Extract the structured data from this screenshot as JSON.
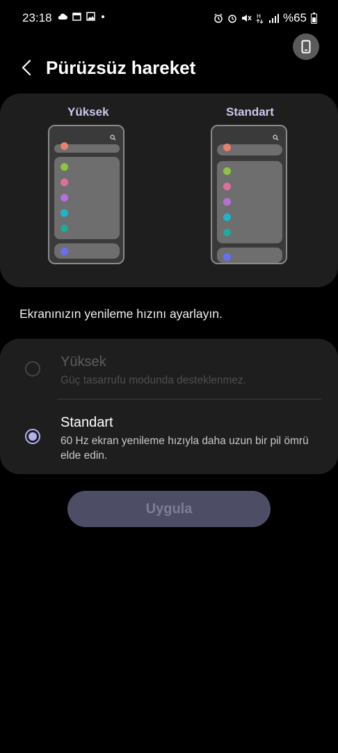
{
  "status_bar": {
    "time": "23:18",
    "battery": "%65",
    "left_icons": [
      "cloud-icon",
      "calendar-icon",
      "image-icon",
      "dot-icon"
    ],
    "right_icons": [
      "alarm-icon",
      "mute-icon",
      "network-hplus-icon",
      "signal-icon",
      "battery-icon"
    ]
  },
  "header": {
    "title": "Pürüzsüz hareket",
    "back_icon": "chevron-left-icon",
    "rotate_icon": "phone-rotate-icon"
  },
  "preview": {
    "high_label": "Yüksek",
    "standard_label": "Standart",
    "dot_colors": [
      "#e8806f",
      "#8bc53f",
      "#e06d9d",
      "#b56fd9",
      "#1eb4cc",
      "#1ea99a",
      "#6b6ef5"
    ]
  },
  "description": "Ekranınızın yenileme hızını ayarlayın.",
  "options": [
    {
      "title": "Yüksek",
      "desc": "Güç tasarrufu modunda desteklenmez.",
      "selected": false,
      "enabled": false
    },
    {
      "title": "Standart",
      "desc": "60 Hz ekran yenileme hızıyla daha uzun bir pil ömrü elde edin.",
      "selected": true,
      "enabled": true
    }
  ],
  "apply_label": "Uygula",
  "colors": {
    "accent": "#b1b1ee",
    "card": "#1e1e1e",
    "background": "#000000"
  }
}
